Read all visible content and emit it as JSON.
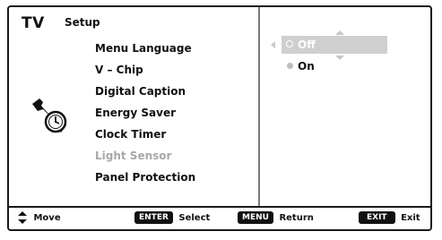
{
  "header": {
    "tv": "TV",
    "section": "Setup"
  },
  "menu": {
    "items": [
      {
        "label": "Menu Language",
        "disabled": false
      },
      {
        "label": "V – Chip",
        "disabled": false
      },
      {
        "label": "Digital Caption",
        "disabled": false
      },
      {
        "label": "Energy Saver",
        "disabled": false
      },
      {
        "label": "Clock Timer",
        "disabled": false
      },
      {
        "label": "Light Sensor",
        "disabled": true
      },
      {
        "label": "Panel Protection",
        "disabled": false
      }
    ]
  },
  "options": {
    "items": [
      {
        "label": "Off",
        "selected": true
      },
      {
        "label": "On",
        "selected": false
      }
    ]
  },
  "footer": {
    "move": "Move",
    "enter_key": "ENTER",
    "select": "Select",
    "menu_key": "MENU",
    "return": "Return",
    "exit_key": "EXIT",
    "exit": "Exit"
  },
  "icons": {
    "setup": "wrench-clock-icon",
    "move": "up-down-arrow-icon"
  },
  "colors": {
    "selected_bg": "#cfcfcf",
    "disabled_text": "#a8a8a8",
    "key_bg": "#111111"
  }
}
